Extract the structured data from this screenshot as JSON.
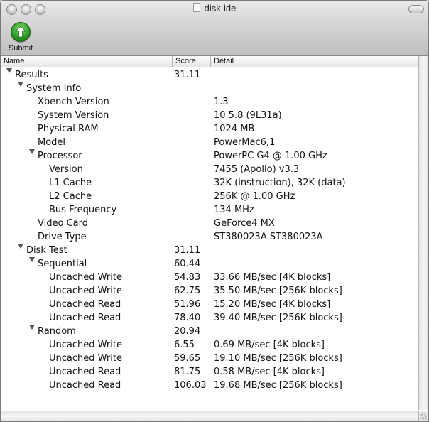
{
  "window": {
    "title": "disk-ide"
  },
  "toolbar": {
    "submit_label": "Submit",
    "submit_icon": "green-up-arrow-icon"
  },
  "columns": {
    "name": "Name",
    "score": "Score",
    "detail": "Detail"
  },
  "rows": [
    {
      "level": 0,
      "expanded": true,
      "name": "Results",
      "score": "31.11",
      "detail": ""
    },
    {
      "level": 1,
      "expanded": true,
      "name": "System Info",
      "score": "",
      "detail": ""
    },
    {
      "level": 2,
      "name": "Xbench Version",
      "score": "",
      "detail": "1.3"
    },
    {
      "level": 2,
      "name": "System Version",
      "score": "",
      "detail": "10.5.8 (9L31a)"
    },
    {
      "level": 2,
      "name": "Physical RAM",
      "score": "",
      "detail": "1024 MB"
    },
    {
      "level": 2,
      "name": "Model",
      "score": "",
      "detail": "PowerMac6,1"
    },
    {
      "level": 2,
      "expanded": true,
      "name": "Processor",
      "score": "",
      "detail": "PowerPC G4 @ 1.00 GHz"
    },
    {
      "level": 3,
      "name": "Version",
      "score": "",
      "detail": "7455 (Apollo) v3.3"
    },
    {
      "level": 3,
      "name": "L1 Cache",
      "score": "",
      "detail": "32K (instruction), 32K (data)"
    },
    {
      "level": 3,
      "name": "L2 Cache",
      "score": "",
      "detail": "256K @ 1.00 GHz"
    },
    {
      "level": 3,
      "name": "Bus Frequency",
      "score": "",
      "detail": "134 MHz"
    },
    {
      "level": 2,
      "name": "Video Card",
      "score": "",
      "detail": "GeForce4 MX"
    },
    {
      "level": 2,
      "name": "Drive Type",
      "score": "",
      "detail": "ST380023A ST380023A"
    },
    {
      "level": 1,
      "expanded": true,
      "name": "Disk Test",
      "score": "31.11",
      "detail": ""
    },
    {
      "level": 2,
      "expanded": true,
      "name": "Sequential",
      "score": "60.44",
      "detail": ""
    },
    {
      "level": 3,
      "name": "Uncached Write",
      "score": "54.83",
      "detail": "33.66 MB/sec [4K blocks]"
    },
    {
      "level": 3,
      "name": "Uncached Write",
      "score": "62.75",
      "detail": "35.50 MB/sec [256K blocks]"
    },
    {
      "level": 3,
      "name": "Uncached Read",
      "score": "51.96",
      "detail": "15.20 MB/sec [4K blocks]"
    },
    {
      "level": 3,
      "name": "Uncached Read",
      "score": "78.40",
      "detail": "39.40 MB/sec [256K blocks]"
    },
    {
      "level": 2,
      "expanded": true,
      "name": "Random",
      "score": "20.94",
      "detail": ""
    },
    {
      "level": 3,
      "name": "Uncached Write",
      "score": "6.55",
      "detail": "0.69 MB/sec [4K blocks]"
    },
    {
      "level": 3,
      "name": "Uncached Write",
      "score": "59.65",
      "detail": "19.10 MB/sec [256K blocks]"
    },
    {
      "level": 3,
      "name": "Uncached Read",
      "score": "81.75",
      "detail": "0.58 MB/sec [4K blocks]"
    },
    {
      "level": 3,
      "name": "Uncached Read",
      "score": "106.03",
      "detail": "19.68 MB/sec [256K blocks]"
    }
  ]
}
